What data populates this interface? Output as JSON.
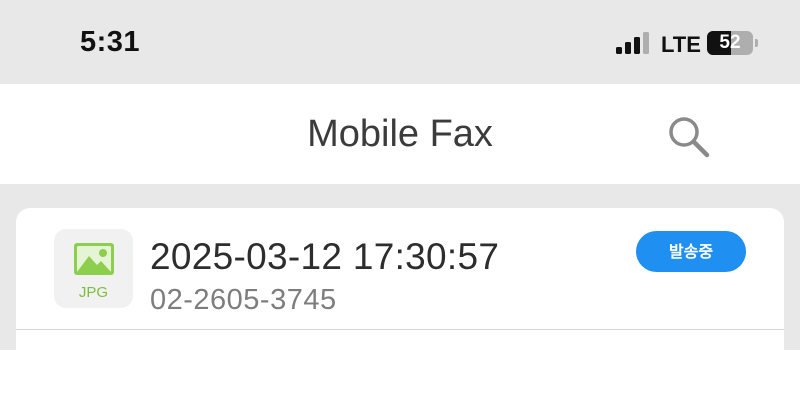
{
  "status_bar": {
    "time": "5:31",
    "network": "LTE",
    "battery_level": "52",
    "battery_fraction": 0.52
  },
  "header": {
    "title": "Mobile Fax",
    "search_icon": "search-icon"
  },
  "fax_list": [
    {
      "file_type": "JPG",
      "file_icon": "image-icon",
      "datetime": "2025-03-12 17:30:57",
      "number": "02-2605-3745",
      "status": "발송중",
      "status_color": "#1f8ff2"
    }
  ]
}
